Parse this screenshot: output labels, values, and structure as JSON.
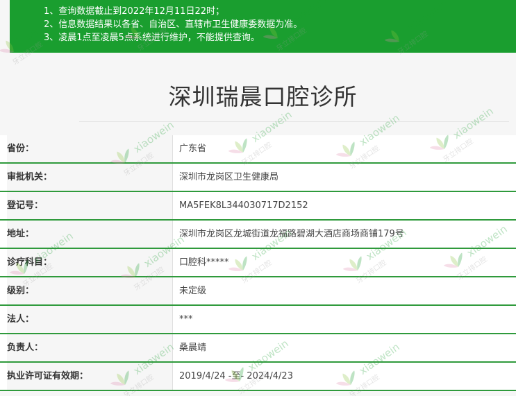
{
  "notice": {
    "lines": [
      "1、查询数据截止到2022年12月11日22时；",
      "2、信息数据结果以各省、自治区、直辖市卫生健康委数据为准。",
      "3、凌晨1点至凌晨5点系统进行维护，不能提供查询。"
    ]
  },
  "page": {
    "title": "深圳瑞晨口腔诊所"
  },
  "rows": [
    {
      "label": "省份：",
      "value": "广东省"
    },
    {
      "label": "审批机关：",
      "value": "深圳市龙岗区卫生健康局"
    },
    {
      "label": "登记号：",
      "value": "MA5FEK8L344030717D2152"
    },
    {
      "label": "地址：",
      "value": "深圳市龙岗区龙城街道龙福路碧湖大酒店商场商铺179号"
    },
    {
      "label": "诊疗科目：",
      "value": "口腔科*****"
    },
    {
      "label": "级别：",
      "value": "未定级"
    },
    {
      "label": "法人：",
      "value": "***"
    },
    {
      "label": "负责人：",
      "value": "桑晨靖"
    },
    {
      "label": "执业许可证有效期：",
      "value": "2019/4/24 -至- 2024/4/23"
    }
  ],
  "watermark": {
    "text": "xiaowein",
    "logo_text": "牙立排口腔",
    "colors": {
      "primary": "#1a9e2f",
      "accent": "#e08ab0",
      "leaf": "#8cc63f"
    }
  },
  "colors": {
    "banner": "#1a9e2f",
    "row_border": "#2f9a3c",
    "label_bg": "#f6f6f6",
    "value_bg": "#ffffff"
  }
}
